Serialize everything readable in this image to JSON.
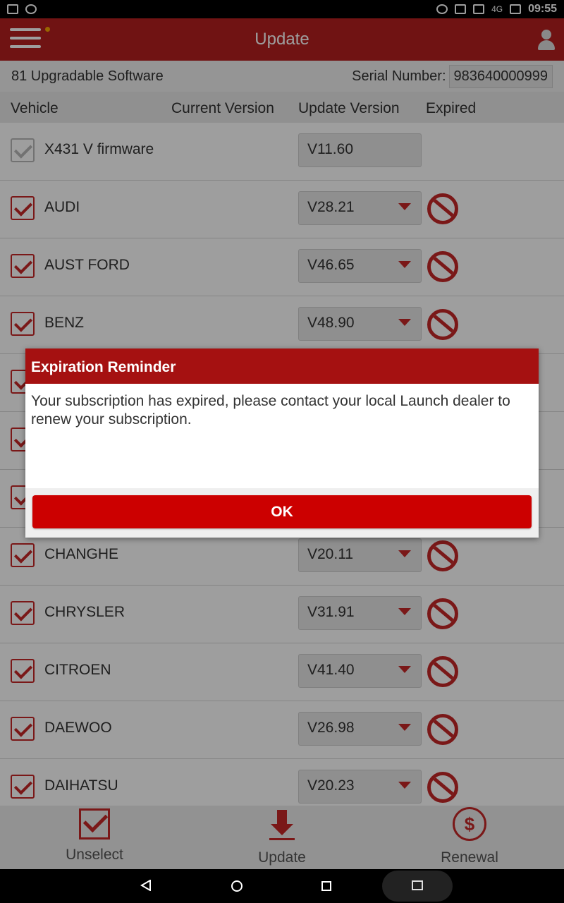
{
  "status_bar": {
    "time": "09:55",
    "network": "4G"
  },
  "header": {
    "title": "Update"
  },
  "info": {
    "upgradable_text": "81 Upgradable Software",
    "serial_label": "Serial Number:",
    "serial_value": "983640000999"
  },
  "columns": {
    "vehicle": "Vehicle",
    "current_version": "Current Version",
    "update_version": "Update Version",
    "expired": "Expired"
  },
  "rows": [
    {
      "name": "X431 V firmware",
      "version": "V11.60"
    },
    {
      "name": "AUDI",
      "version": "V28.21"
    },
    {
      "name": "AUST FORD",
      "version": "V46.65"
    },
    {
      "name": "BENZ",
      "version": "V48.90"
    },
    {
      "name": "",
      "version": ""
    },
    {
      "name": "",
      "version": ""
    },
    {
      "name": "",
      "version": ""
    },
    {
      "name": "CHANGHE",
      "version": "V20.11"
    },
    {
      "name": "CHRYSLER",
      "version": "V31.91"
    },
    {
      "name": "CITROEN",
      "version": "V41.40"
    },
    {
      "name": "DAEWOO",
      "version": "V26.98"
    },
    {
      "name": "DAIHATSU",
      "version": "V20.23"
    }
  ],
  "dialog": {
    "title": "Expiration Reminder",
    "message": "Your subscription has expired, please contact your local Launch dealer to renew your subscription.",
    "ok_label": "OK"
  },
  "bottom_bar": {
    "unselect": "Unselect",
    "update": "Update",
    "renewal": "Renewal",
    "renewal_symbol": "$"
  },
  "colors": {
    "header": "#b51f1f",
    "accent": "#c62828",
    "dialog_title": "#a51111",
    "ok_button": "#cc0000"
  }
}
